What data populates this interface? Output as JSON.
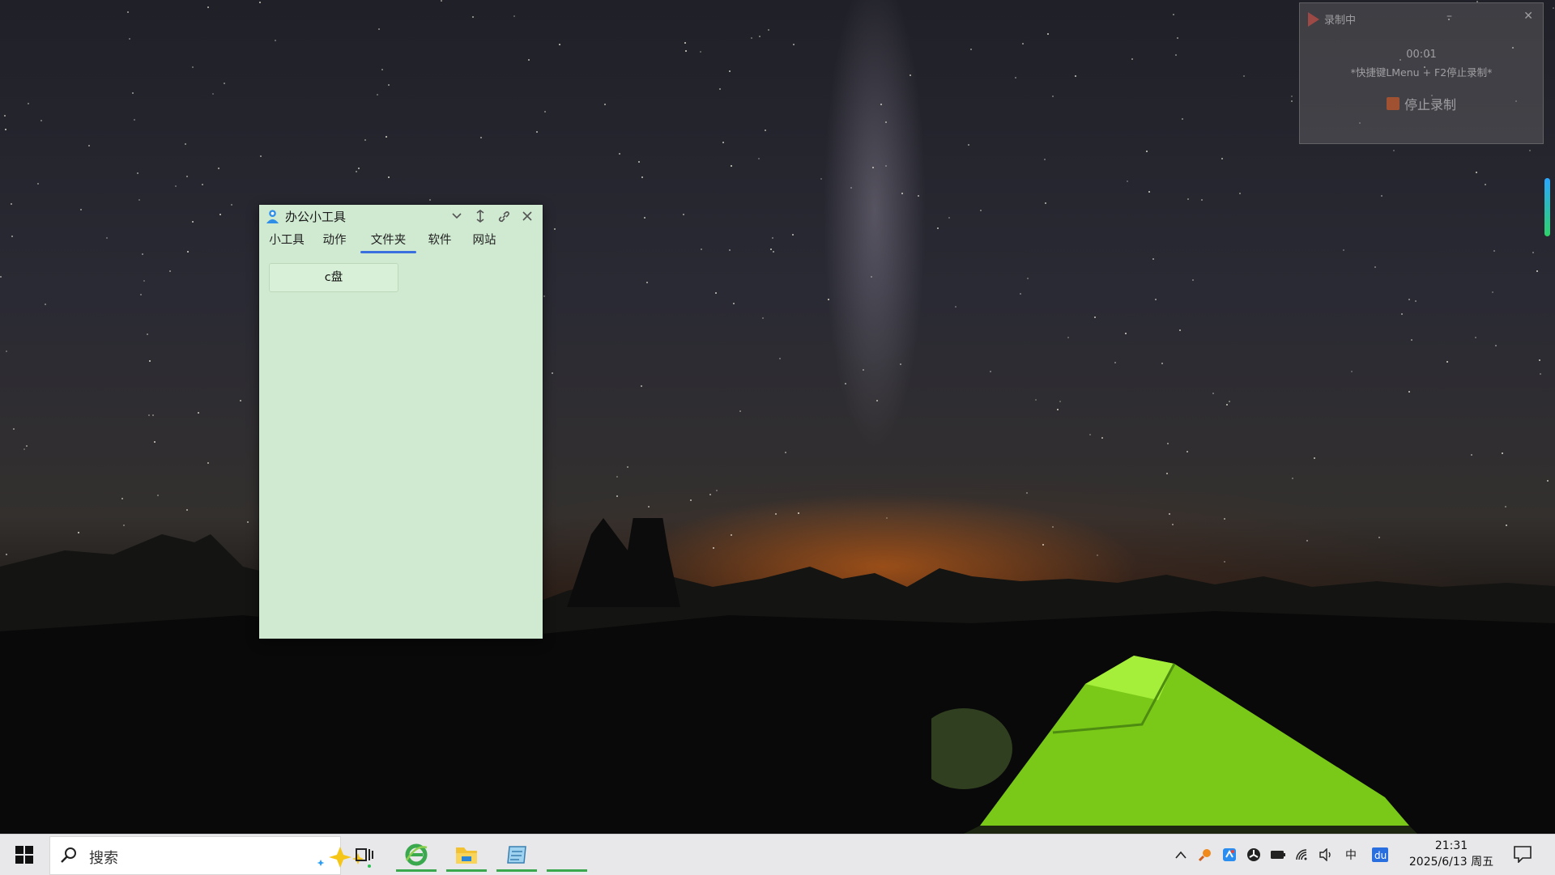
{
  "app_window": {
    "title": "办公小工具",
    "tabs": [
      {
        "label": "小工具",
        "active": false
      },
      {
        "label": "动作",
        "active": false
      },
      {
        "label": "文件夹",
        "active": true
      },
      {
        "label": "软件",
        "active": false
      },
      {
        "label": "网站",
        "active": false
      }
    ],
    "folder_buttons": [
      {
        "label": "c盘"
      }
    ],
    "accent_color": "#3a6fe0",
    "background_color": "#d0ead1"
  },
  "recorder": {
    "title": "录制中",
    "elapsed": "00:01",
    "hint": "*快捷键LMenu + F2停止录制*",
    "stop_label": "停止录制"
  },
  "taskbar": {
    "search_placeholder": "搜索",
    "apps": [
      "ie-icon",
      "file-explorer-icon",
      "notepad-icon",
      "app-icon"
    ],
    "tray": {
      "input_method": "中",
      "time": "21:31",
      "date": "2025/6/13 周五"
    }
  }
}
